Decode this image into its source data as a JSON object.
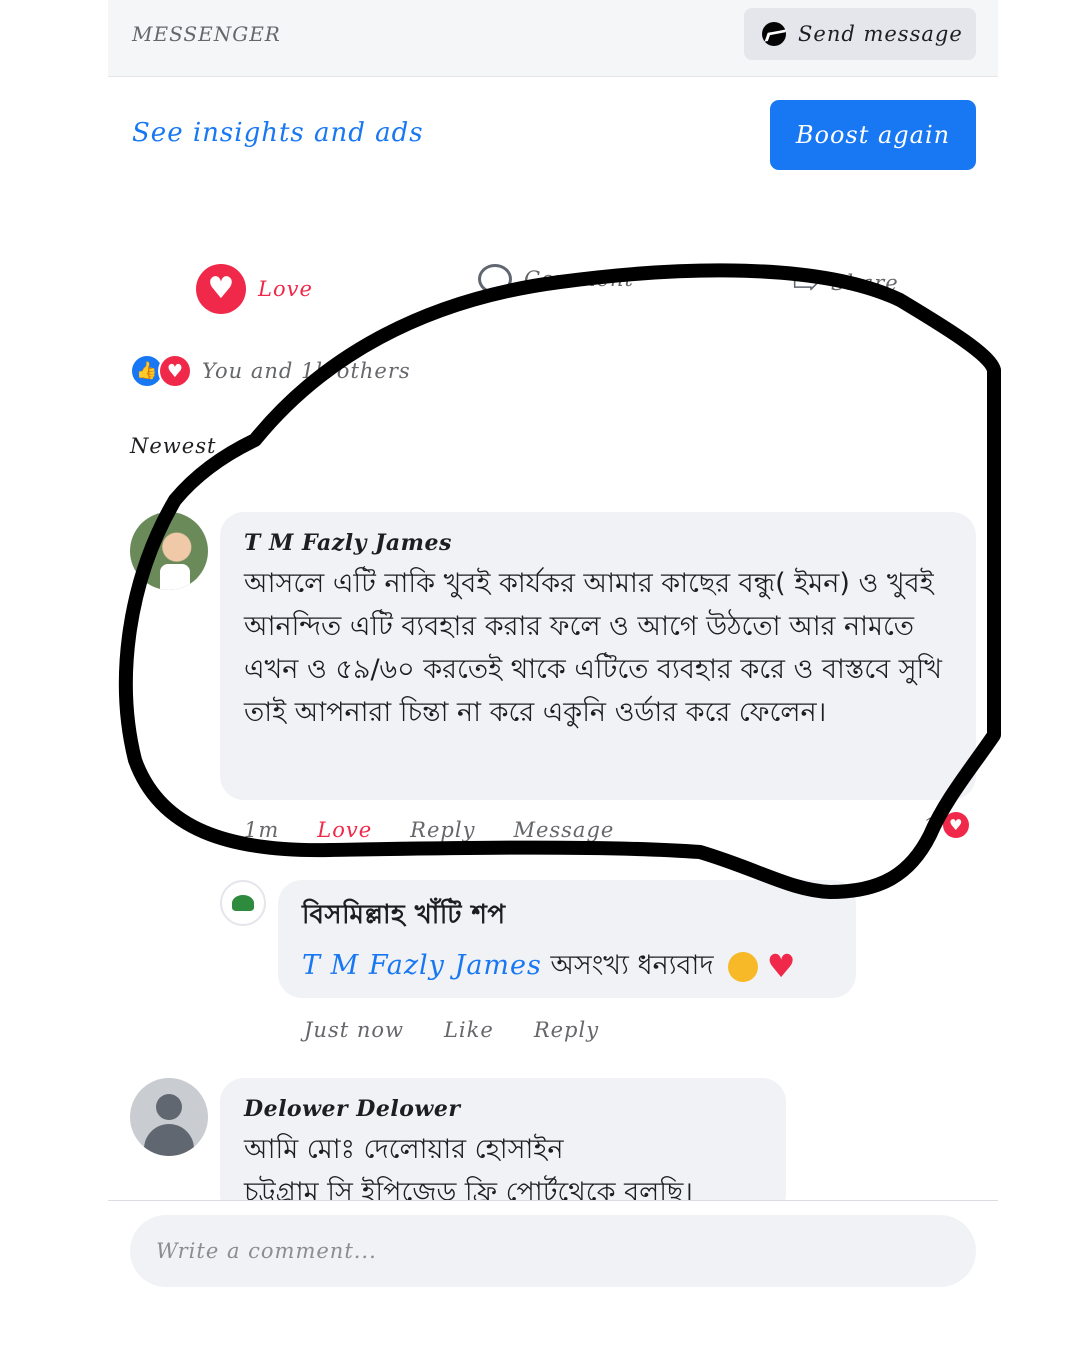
{
  "messenger": {
    "title": "MESSENGER",
    "send_label": "Send message"
  },
  "promo": {
    "insights_link": "See insights and ads",
    "boost_label": "Boost again"
  },
  "actions": {
    "love": "Love",
    "comment": "Comment",
    "share": "Share"
  },
  "reactions_summary": "You and 1k others",
  "sort_label": "Newest",
  "comments": [
    {
      "author": "T M Fazly James",
      "text": "আসলে এটি নাকি খুবই কার্যকর আমার কাছের বন্ধু( ইমন) ও খুবই আনন্দিত এটি ব্যবহার করার ফলে ও আগে উঠতো আর নামতে এখন ও ৫৯/৬০ করতেই থাকে এটিতে ব্যবহার করে ও বাস্তবে সুখি তাই আপনারা চিন্তা না করে একুনি ওর্ডার করে ফেলেন।",
      "time": "1m",
      "reaction": "Love",
      "reply": "Reply",
      "message": "Message",
      "reaction_count": "1"
    },
    {
      "author": "বিসমিল্লাহ খাঁটি শপ",
      "mention": "T M Fazly James",
      "text": "অসংখ্য ধন্যবাদ",
      "time": "Just now",
      "like": "Like",
      "reply": "Reply"
    },
    {
      "author": "Delower Delower",
      "text": "আমি মোঃ দেলোয়ার হোসাইন",
      "text2": "চট্টগ্রাম সি ইপিজেড ফ্রি পোর্টথেকে বলছি।"
    }
  ],
  "composer": {
    "placeholder": "Write a comment..."
  },
  "colors": {
    "brand_blue": "#1877f2",
    "love_red": "#f02849",
    "bubble_gray": "#f0f2f5"
  }
}
